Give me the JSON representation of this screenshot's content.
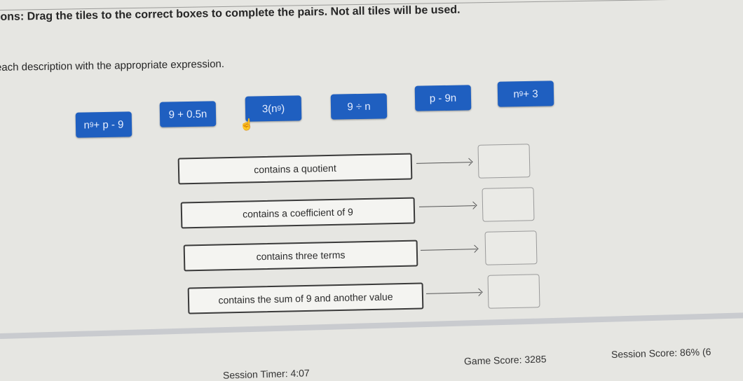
{
  "instructions": {
    "main": "ions: Drag the tiles to the correct boxes to complete the pairs. Not all tiles will be used.",
    "sub": "each description with the appropriate expression."
  },
  "tiles": [
    {
      "base": "n",
      "exp": "9",
      "rest": " + p - 9"
    },
    {
      "base": "9 + 0.5n",
      "exp": "",
      "rest": ""
    },
    {
      "base": "3(n",
      "exp": "9",
      "rest": ")"
    },
    {
      "base": "9 ÷ n",
      "exp": "",
      "rest": ""
    },
    {
      "base": "p - 9n",
      "exp": "",
      "rest": ""
    },
    {
      "base": "n",
      "exp": "9",
      "rest": " + 3"
    }
  ],
  "descriptions": [
    "contains a quotient",
    "contains a coefficient of 9",
    "contains three terms",
    "contains the sum of 9 and another value"
  ],
  "footer": {
    "timer": "Session Timer: 4:07",
    "game_score": "Game Score: 3285",
    "session_score": "Session Score: 86% (6"
  },
  "colors": {
    "tile": "#1f5fc0",
    "tile_text": "#e8efff"
  }
}
